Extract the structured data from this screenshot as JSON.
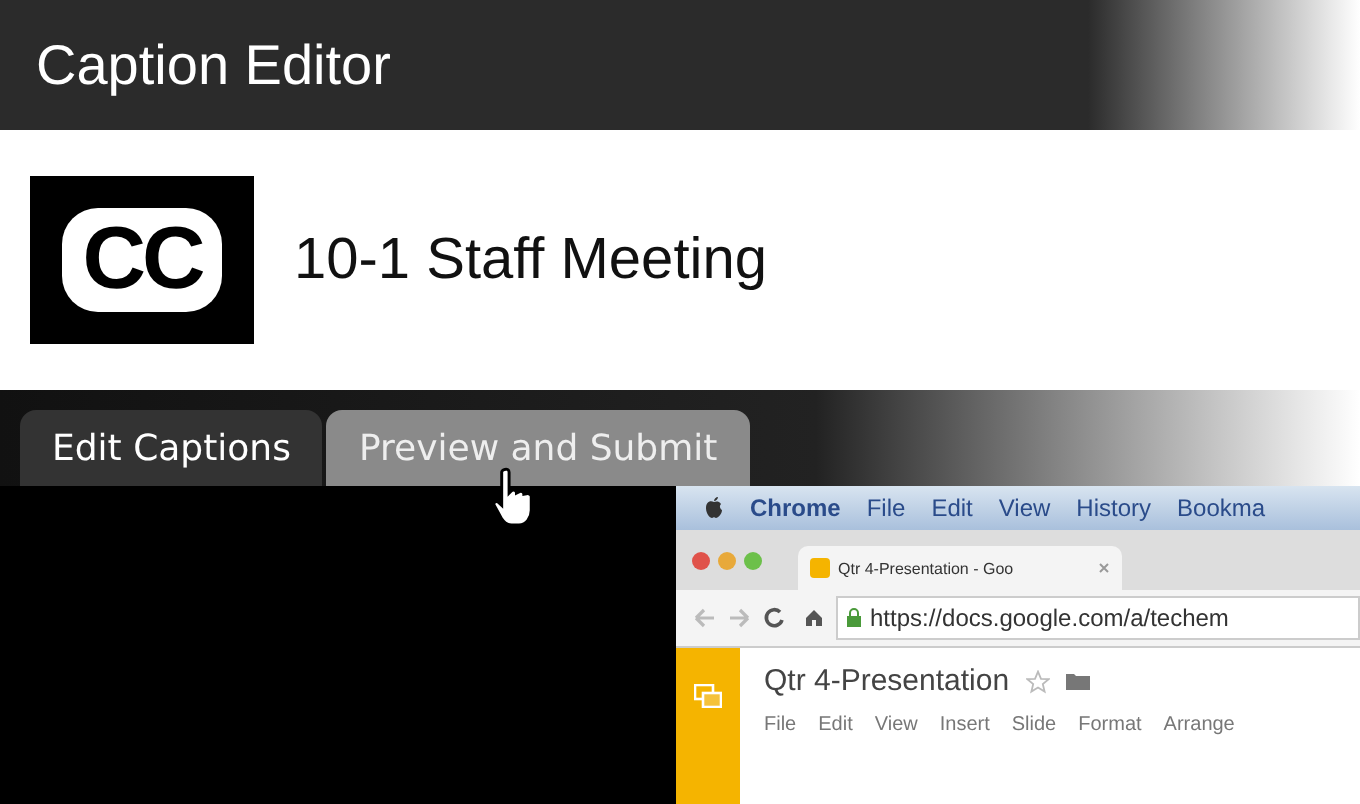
{
  "window": {
    "title": "Caption Editor"
  },
  "video": {
    "logo": "CC",
    "title": "10-1 Staff Meeting"
  },
  "tabs": [
    {
      "label": "Edit Captions",
      "selected": true
    },
    {
      "label": "Preview and Submit",
      "selected": false
    }
  ],
  "embedded_screen": {
    "menu_bar": [
      "Chrome",
      "File",
      "Edit",
      "View",
      "History",
      "Bookma"
    ],
    "browser_tab": "Qtr 4-Presentation - Goo",
    "address": "https://docs.google.com/a/techem",
    "document": {
      "title": "Qtr 4-Presentation",
      "menu": [
        "File",
        "Edit",
        "View",
        "Insert",
        "Slide",
        "Format",
        "Arrange"
      ]
    }
  }
}
